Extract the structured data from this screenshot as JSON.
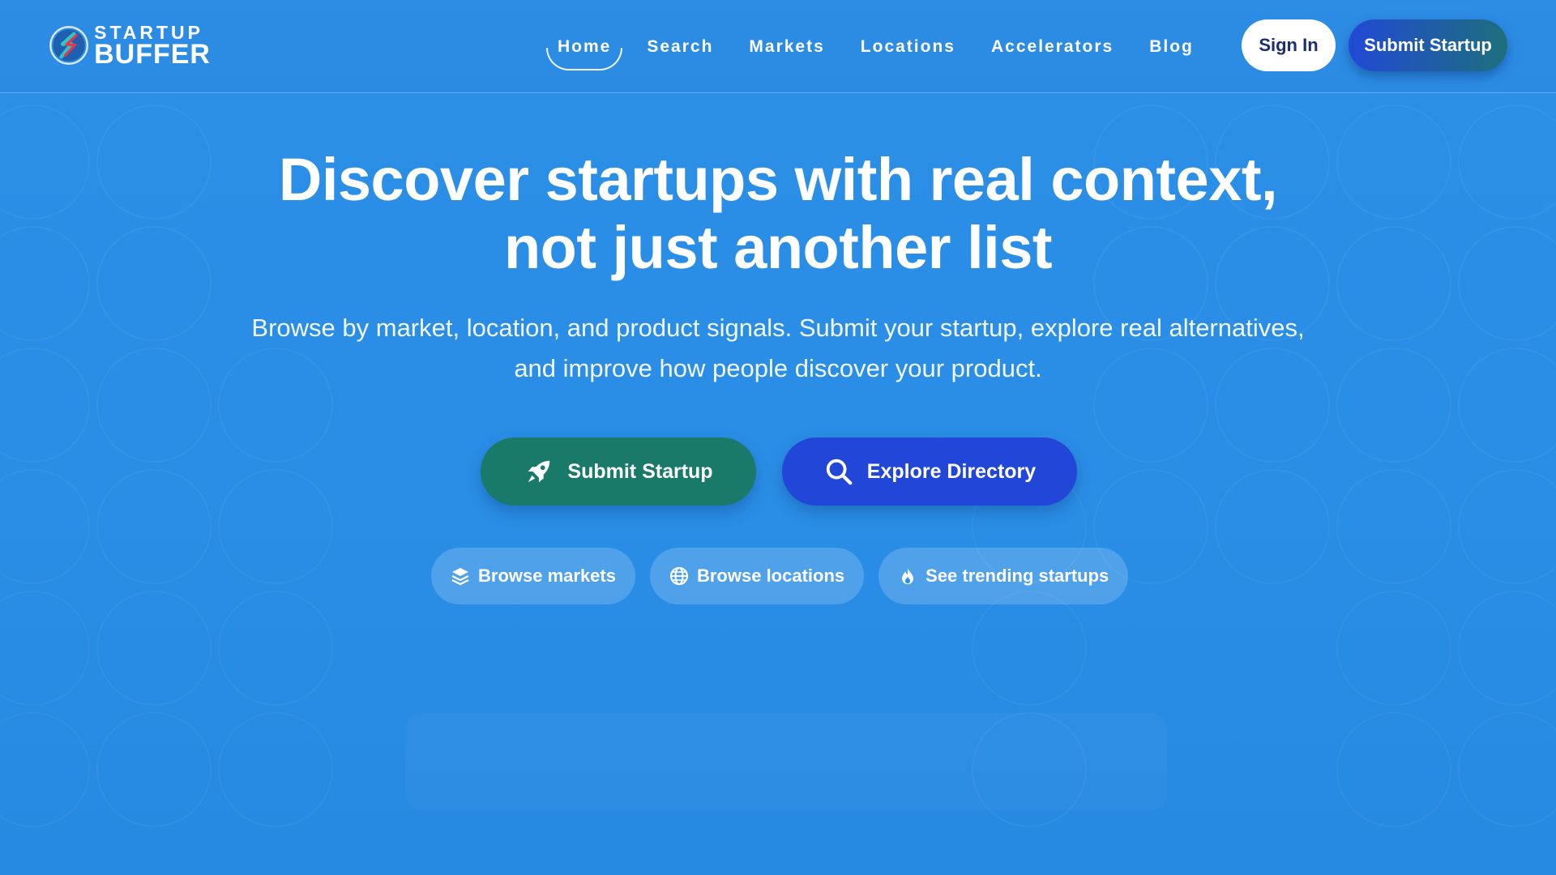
{
  "brand": {
    "logo_top": "STARTUP",
    "logo_bottom": "BUFFER",
    "accent_colors": [
      "#e8334a",
      "#2ec4c4"
    ]
  },
  "nav": {
    "items": [
      {
        "label": "Home",
        "active": true
      },
      {
        "label": "Search",
        "active": false
      },
      {
        "label": "Markets",
        "active": false
      },
      {
        "label": "Locations",
        "active": false
      },
      {
        "label": "Accelerators",
        "active": false
      },
      {
        "label": "Blog",
        "active": false
      }
    ],
    "sign_in": "Sign In",
    "submit": "Submit Startup"
  },
  "hero": {
    "title_line1": "Discover startups with real context,",
    "title_line2": "not just another list",
    "subtitle_line1": "Browse by market, location, and product signals. Submit your startup, explore real alternatives,",
    "subtitle_line2": "and improve how people discover your product."
  },
  "cta": {
    "primary": {
      "label": "Submit Startup",
      "icon": "rocket-icon",
      "color": "#197a6a"
    },
    "secondary": {
      "label": "Explore Directory",
      "icon": "search-icon",
      "color": "#2247d8"
    }
  },
  "chips": [
    {
      "label": "Browse markets",
      "icon": "layers-icon"
    },
    {
      "label": "Browse locations",
      "icon": "globe-icon"
    },
    {
      "label": "See trending startups",
      "icon": "flame-icon"
    }
  ],
  "colors": {
    "background": "#2a8ee6",
    "signin_text": "#1b2f6e"
  }
}
